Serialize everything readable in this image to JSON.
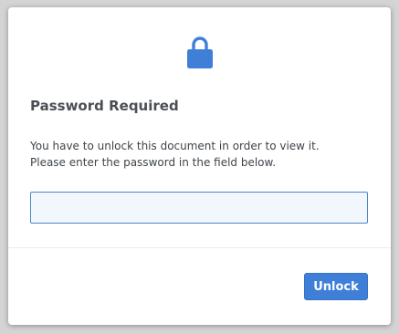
{
  "dialog": {
    "icon": "lock-icon",
    "title": "Password Required",
    "message_line1": "You have to unlock this document in order to view it.",
    "message_line2": "Please enter the password in the field below.",
    "password_value": "",
    "unlock_label": "Unlock"
  },
  "colors": {
    "accent": "#3f7fd8",
    "icon": "#3f7fd8",
    "title": "#4a4f55",
    "backdrop": "#d4d4d4"
  }
}
